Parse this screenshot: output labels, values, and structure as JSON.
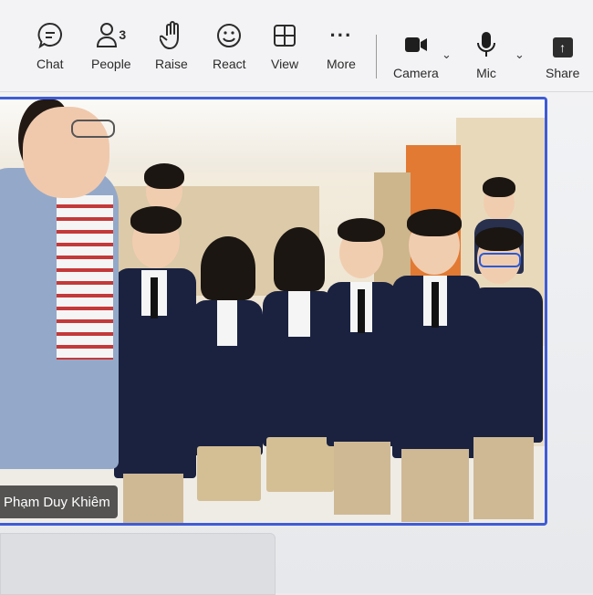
{
  "toolbar": {
    "chat_label": "Chat",
    "people_label": "People",
    "people_count": "3",
    "raise_label": "Raise",
    "react_label": "React",
    "view_label": "View",
    "more_label": "More",
    "camera_label": "Camera",
    "mic_label": "Mic",
    "share_label": "Share"
  },
  "video": {
    "participant_name": "Phạm Duy Khiêm"
  },
  "colors": {
    "active_speaker_border": "#3f5bd6",
    "toolbar_bg": "#f3f3f5",
    "name_tag_bg": "#282828"
  },
  "icons": {
    "chat": "chat-bubble-icon",
    "people": "people-icon",
    "raise": "hand-icon",
    "react": "smiley-icon",
    "view": "grid-icon",
    "more": "ellipsis-icon",
    "camera": "camera-icon",
    "mic": "microphone-icon",
    "share": "share-arrow-icon"
  }
}
